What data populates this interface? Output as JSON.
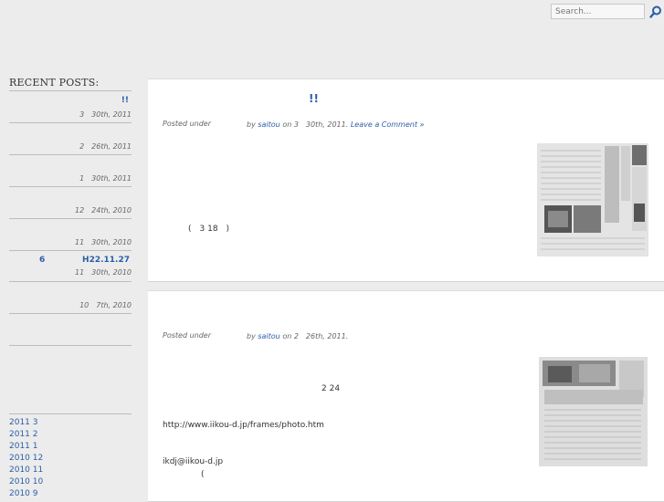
{
  "search": {
    "placeholder": "Search..."
  },
  "sidebar": {
    "title": "RECENT POSTS:",
    "posts": [
      {
        "title": "!!",
        "date": "3　30th, 2011"
      },
      {
        "title": "",
        "date": "2　26th, 2011"
      },
      {
        "title": "",
        "date": "1　30th, 2011"
      },
      {
        "title": "",
        "date": "12　24th, 2010"
      },
      {
        "title": "",
        "date": "11　30th, 2010"
      },
      {
        "title_left": "6",
        "title": "H22.11.27",
        "date": "11　30th, 2010"
      },
      {
        "title": "",
        "date": "10　7th, 2010"
      }
    ],
    "archives": [
      "2011 3",
      "2011 2",
      "2011 1",
      "2010 12",
      "2010 11",
      "2010 10",
      "2010 9"
    ]
  },
  "posts": [
    {
      "title": "!!",
      "posted_under": "Posted under",
      "by": "by",
      "author": "saitou",
      "on": "on 3　30th, 2011.",
      "comment": "Leave a Comment »",
      "body": [
        "(　3 18　)"
      ]
    },
    {
      "posted_under": "Posted under",
      "by": "by",
      "author": "saitou",
      "on": "on 2　26th, 2011.",
      "body": [
        "2 24",
        "http://www.iikou-d.jp/frames/photo.htm",
        "ikdj@iikou-d.jp",
        "("
      ]
    }
  ],
  "colors": {
    "link": "#2a5ea8",
    "background": "#ececec"
  }
}
